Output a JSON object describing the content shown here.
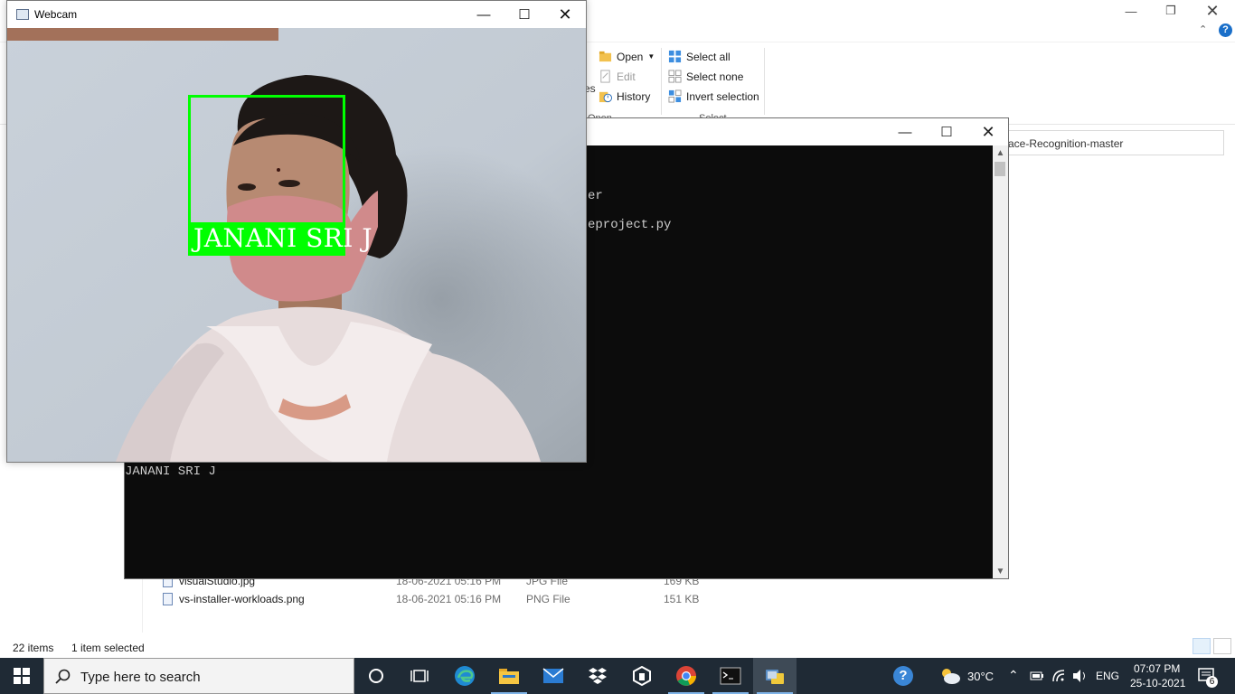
{
  "explorer": {
    "ribbon": {
      "open_label": "Open",
      "edit_label": "Edit",
      "history_label": "History",
      "open_group": "Open",
      "partial_label": "es",
      "select_all": "Select all",
      "select_none": "Select none",
      "invert_selection": "Invert selection",
      "select_group": "Select"
    },
    "address_text": "ace-Recognition-master",
    "files": [
      {
        "name": "visualStudio.jpg",
        "date": "18-06-2021 05:16 PM",
        "type": "JPG File",
        "size": "169 KB"
      },
      {
        "name": "vs-installer-workloads.png",
        "date": "18-06-2021 05:16 PM",
        "type": "PNG File",
        "size": "151 KB"
      }
    ],
    "status": {
      "items": "22 items",
      "selected": "1 item selected"
    }
  },
  "console": {
    "line1": "er",
    "line2": "eproject.py",
    "output": "JANANI SRI J"
  },
  "webcam": {
    "title": "Webcam",
    "detected_name": "JANANI SRI J",
    "box_color": "#00ff00"
  },
  "taskbar": {
    "search_placeholder": "Type here to search",
    "weather": "30°C",
    "language": "ENG",
    "time": "07:07 PM",
    "date": "25-10-2021",
    "notifications": "6"
  }
}
